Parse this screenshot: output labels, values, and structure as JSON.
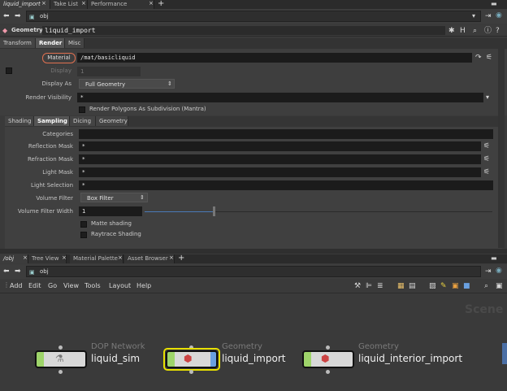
{
  "top_tabs": [
    "liquid_import",
    "Take List",
    "Performance Monitor"
  ],
  "top_path": "obj",
  "node_header": {
    "type": "Geometry",
    "name": "liquid_import"
  },
  "param_tabs": [
    "Transform",
    "Render",
    "Misc"
  ],
  "render": {
    "material_label": "Material",
    "material_value": "/mat/basicliquid",
    "display_label": "Display",
    "display_value": "1",
    "display_as_label": "Display As",
    "display_as_value": "Full Geometry",
    "render_visibility_label": "Render Visibility",
    "render_visibility_value": "*",
    "render_polygons_label": "Render Polygons As Subdivision (Mantra)"
  },
  "sub_tabs": [
    "Shading",
    "Sampling",
    "Dicing",
    "Geometry"
  ],
  "sampling": {
    "categories_label": "Categories",
    "categories_value": "",
    "reflection_mask_label": "Reflection Mask",
    "reflection_mask_value": "*",
    "refraction_mask_label": "Refraction Mask",
    "refraction_mask_value": "*",
    "light_mask_label": "Light Mask",
    "light_mask_value": "*",
    "light_selection_label": "Light Selection",
    "light_selection_value": "*",
    "volume_filter_label": "Volume Filter",
    "volume_filter_value": "Box Filter",
    "volume_filter_width_label": "Volume Filter Width",
    "volume_filter_width_value": "1",
    "matte_shading_label": "Matte shading",
    "raytrace_shading_label": "Raytrace Shading"
  },
  "bottom_tabs": [
    "/obj",
    "Tree View",
    "Material Palette",
    "Asset Browser"
  ],
  "bottom_path": "obj",
  "menu": [
    "Add",
    "Edit",
    "Go",
    "View",
    "Tools",
    "Layout",
    "Help"
  ],
  "scene_watermark": "Scene",
  "nodes": [
    {
      "type": "DOP Network",
      "name": "liquid_sim"
    },
    {
      "type": "Geometry",
      "name": "liquid_import"
    },
    {
      "type": "Geometry",
      "name": "liquid_interior_import"
    }
  ],
  "colors": {
    "accent_selected": "#e8e000",
    "node_green": "#9ed46a",
    "highlight_ring": "#e07050"
  }
}
